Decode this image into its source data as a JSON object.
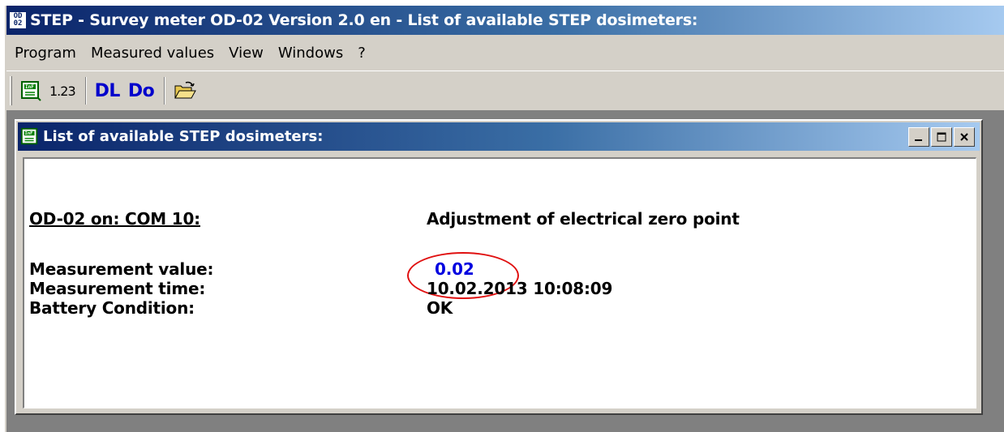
{
  "window": {
    "title": "STEP - Survey meter OD-02  Version 2.0 en - List of available STEP dosimeters:",
    "icon_label_top": "OD",
    "icon_label_bottom": "02"
  },
  "menu": [
    "Program",
    "Measured values",
    "View",
    "Windows",
    "?"
  ],
  "toolbar": {
    "buttons": [
      {
        "name": "inf-list-icon",
        "label": ""
      },
      {
        "name": "numeric-icon",
        "label": "1.23"
      },
      {
        "name": "dl-button",
        "label": "DL"
      },
      {
        "name": "do-button",
        "label": "Do"
      },
      {
        "name": "open-folder-icon",
        "label": ""
      }
    ]
  },
  "child_window": {
    "title": "List of available STEP dosimeters:",
    "device_label": "OD-02 on: COM 10:",
    "status_heading": "Adjustment of electrical zero point",
    "fields": [
      {
        "label": "Measurement value:",
        "value": "0.02"
      },
      {
        "label": "Measurement time:",
        "value": "10.02.2013 10:08:09"
      },
      {
        "label": "Battery Condition:",
        "value": "OK"
      }
    ]
  },
  "colors": {
    "title_gradient_start": "#0a246a",
    "title_gradient_end": "#a6caf0",
    "value_blue": "#0000e0",
    "annotation_red": "#e01010"
  }
}
